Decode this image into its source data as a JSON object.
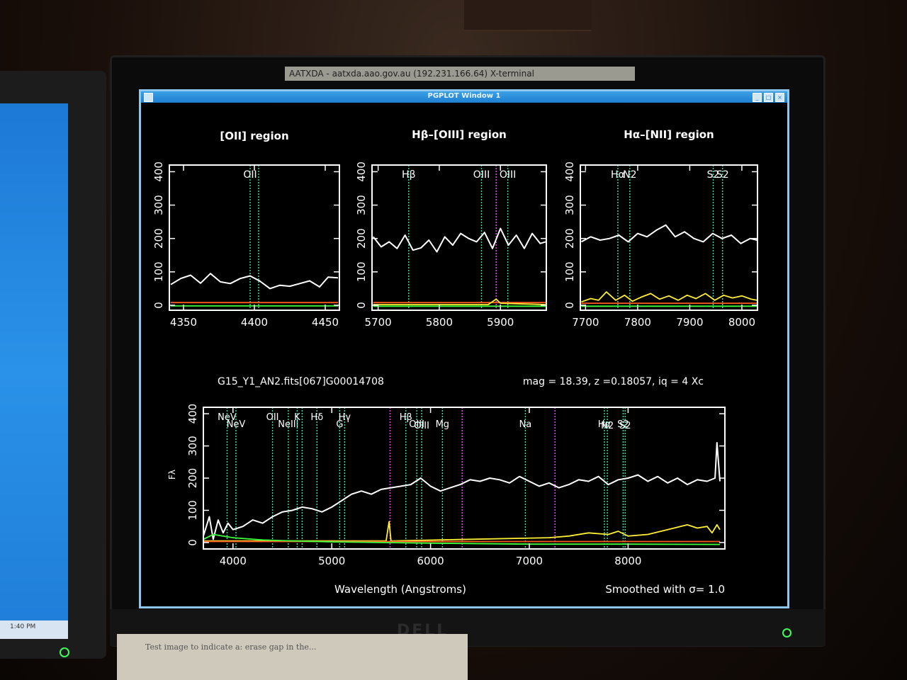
{
  "xterm_title": "AATXDA - aatxda.aao.gov.au (192.231.166.64) X-terminal",
  "window": {
    "title": "PGPLOT Window 1"
  },
  "left_monitor": {
    "clock": "1:40 PM"
  },
  "monitor_brand": "DELL",
  "note_text": "Test image to indicate a: erase gap in the...",
  "chart_data": [
    {
      "id": "oii",
      "type": "line",
      "title": "[OII] region",
      "xlim": [
        4340,
        4460
      ],
      "ylim": [
        -15,
        420
      ],
      "xticks": [
        4350,
        4400,
        4450
      ],
      "yticks": [
        0,
        100,
        200,
        300,
        400
      ],
      "lines": [
        {
          "x": 4397,
          "color": "#33e5b0",
          "label": "OII"
        },
        {
          "x": 4403,
          "color": "#33e5b0",
          "label": ""
        }
      ],
      "series": [
        {
          "color": "#ffffff",
          "x": [
            4341,
            4348,
            4355,
            4362,
            4369,
            4376,
            4383,
            4390,
            4397,
            4404,
            4411,
            4418,
            4425,
            4432,
            4439,
            4446,
            4452,
            4459
          ],
          "y": [
            62,
            80,
            90,
            66,
            95,
            70,
            65,
            80,
            88,
            72,
            50,
            60,
            57,
            65,
            73,
            55,
            84,
            82
          ]
        },
        {
          "color": "#ff5a1e",
          "x": [
            4341,
            4459
          ],
          "y": [
            8,
            8
          ]
        },
        {
          "color": "#3cff3c",
          "x": [
            4341,
            4459
          ],
          "y": [
            -2,
            -2
          ]
        }
      ]
    },
    {
      "id": "hb_oiii",
      "type": "line",
      "title": "Hβ–[OIII] region",
      "xlim": [
        5690,
        5975
      ],
      "ylim": [
        -15,
        420
      ],
      "xticks": [
        5700,
        5800,
        5900
      ],
      "yticks": [
        0,
        100,
        200,
        300,
        400
      ],
      "lines": [
        {
          "x": 5750,
          "color": "#33e5b0",
          "label": "Hβ"
        },
        {
          "x": 5869,
          "color": "#33e5b0",
          "label": "OIII"
        },
        {
          "x": 5893,
          "color": "#ff44ff",
          "label": ""
        },
        {
          "x": 5912,
          "color": "#33e5b0",
          "label": "OIII"
        }
      ],
      "series": [
        {
          "color": "#ffffff",
          "x": [
            5692,
            5705,
            5718,
            5731,
            5744,
            5757,
            5770,
            5783,
            5796,
            5809,
            5822,
            5835,
            5848,
            5861,
            5874,
            5887,
            5900,
            5913,
            5926,
            5939,
            5952,
            5965,
            5974
          ],
          "y": [
            205,
            175,
            190,
            170,
            210,
            165,
            172,
            195,
            160,
            205,
            180,
            215,
            200,
            190,
            218,
            170,
            230,
            180,
            210,
            170,
            215,
            185,
            190
          ]
        },
        {
          "color": "#ff5a1e",
          "x": [
            5692,
            5974
          ],
          "y": [
            8,
            8
          ]
        },
        {
          "color": "#ffee33",
          "x": [
            5692,
            5880,
            5893,
            5900,
            5974
          ],
          "y": [
            2,
            2,
            18,
            6,
            2
          ]
        },
        {
          "color": "#3cff3c",
          "x": [
            5692,
            5974
          ],
          "y": [
            -3,
            -3
          ]
        }
      ]
    },
    {
      "id": "ha_nii",
      "type": "line",
      "title": "Hα–[NII] region",
      "xlim": [
        7690,
        8030
      ],
      "ylim": [
        -15,
        420
      ],
      "xticks": [
        7700,
        7800,
        7900,
        8000
      ],
      "yticks": [
        0,
        100,
        200,
        300,
        400
      ],
      "lines": [
        {
          "x": 7762,
          "color": "#33e5b0",
          "label": "Hα"
        },
        {
          "x": 7785,
          "color": "#33e5b0",
          "label": "N2"
        },
        {
          "x": 7945,
          "color": "#33e5b0",
          "label": "S2"
        },
        {
          "x": 7963,
          "color": "#33e5b0",
          "label": "S2"
        }
      ],
      "series": [
        {
          "color": "#ffffff",
          "x": [
            7692,
            7710,
            7728,
            7746,
            7764,
            7782,
            7800,
            7818,
            7836,
            7854,
            7872,
            7890,
            7908,
            7926,
            7944,
            7962,
            7980,
            7998,
            8016,
            8029
          ],
          "y": [
            190,
            205,
            195,
            200,
            210,
            190,
            215,
            205,
            225,
            240,
            205,
            220,
            200,
            190,
            215,
            200,
            210,
            185,
            200,
            195
          ]
        },
        {
          "color": "#ffee33",
          "x": [
            7692,
            7710,
            7725,
            7740,
            7758,
            7775,
            7790,
            7808,
            7825,
            7842,
            7860,
            7878,
            7895,
            7912,
            7930,
            7948,
            7965,
            7982,
            8000,
            8018,
            8029
          ],
          "y": [
            10,
            20,
            15,
            40,
            15,
            30,
            12,
            25,
            35,
            18,
            28,
            15,
            30,
            20,
            35,
            15,
            30,
            22,
            28,
            18,
            15
          ]
        },
        {
          "color": "#ff5a1e",
          "x": [
            7692,
            8029
          ],
          "y": [
            6,
            6
          ]
        },
        {
          "color": "#3cff3c",
          "x": [
            7692,
            8029
          ],
          "y": [
            -3,
            -3
          ]
        }
      ]
    },
    {
      "id": "full",
      "type": "line",
      "header_left": "G15_Y1_AN2.fits[067]G00014708",
      "header_right": "mag = 18.39, z =0.18057, iq =  4 Xc",
      "xlabel": "Wavelength (Angstroms)",
      "ylabel": "Fλ",
      "note": "Smoothed with σ= 1.0",
      "xlim": [
        3700,
        8980
      ],
      "ylim": [
        -20,
        420
      ],
      "xticks": [
        4000,
        5000,
        6000,
        7000,
        8000
      ],
      "yticks": [
        0,
        100,
        200,
        300,
        400
      ],
      "lines": [
        {
          "x": 3940,
          "color": "#33e5b0",
          "label": "NeV"
        },
        {
          "x": 4030,
          "color": "#33e5b0",
          "label": "NeV"
        },
        {
          "x": 4400,
          "color": "#33e5b0",
          "label": "OII"
        },
        {
          "x": 4560,
          "color": "#33e5b0",
          "label": "NeIII"
        },
        {
          "x": 4650,
          "color": "#33e5b0",
          "label": "K"
        },
        {
          "x": 4700,
          "color": "#33e5b0",
          "label": ""
        },
        {
          "x": 4850,
          "color": "#33e5b0",
          "label": "Hδ"
        },
        {
          "x": 5080,
          "color": "#33e5b0",
          "label": "G"
        },
        {
          "x": 5130,
          "color": "#33e5b0",
          "label": "Hγ"
        },
        {
          "x": 5590,
          "color": "#ff44ff",
          "label": ""
        },
        {
          "x": 5750,
          "color": "#33e5b0",
          "label": "Hβ"
        },
        {
          "x": 5860,
          "color": "#33e5b0",
          "label": "OIII"
        },
        {
          "x": 5910,
          "color": "#33e5b0",
          "label": "OIII"
        },
        {
          "x": 6120,
          "color": "#33e5b0",
          "label": "Mg"
        },
        {
          "x": 6320,
          "color": "#ff44ff",
          "label": ""
        },
        {
          "x": 6960,
          "color": "#33e5b0",
          "label": "Na"
        },
        {
          "x": 7260,
          "color": "#ff44ff",
          "label": ""
        },
        {
          "x": 7760,
          "color": "#33e5b0",
          "label": "Hα"
        },
        {
          "x": 7790,
          "color": "#33e5b0",
          "label": "N2"
        },
        {
          "x": 7950,
          "color": "#33e5b0",
          "label": "S2"
        },
        {
          "x": 7970,
          "color": "#33e5b0",
          "label": "S2"
        }
      ],
      "series": [
        {
          "color": "#ffffff",
          "x": [
            3700,
            3760,
            3800,
            3850,
            3900,
            3950,
            4000,
            4100,
            4200,
            4300,
            4400,
            4500,
            4600,
            4700,
            4800,
            4900,
            5000,
            5100,
            5200,
            5300,
            5400,
            5500,
            5600,
            5700,
            5800,
            5900,
            6000,
            6100,
            6200,
            6300,
            6400,
            6500,
            6600,
            6700,
            6800,
            6900,
            7000,
            7100,
            7200,
            7300,
            7400,
            7500,
            7600,
            7700,
            7800,
            7900,
            8000,
            8100,
            8200,
            8300,
            8400,
            8500,
            8600,
            8700,
            8800,
            8880,
            8900,
            8930
          ],
          "y": [
            20,
            80,
            10,
            70,
            30,
            60,
            40,
            50,
            70,
            60,
            80,
            95,
            100,
            110,
            105,
            95,
            110,
            130,
            150,
            160,
            150,
            165,
            170,
            175,
            180,
            200,
            175,
            160,
            170,
            180,
            195,
            190,
            200,
            195,
            185,
            205,
            190,
            175,
            185,
            170,
            180,
            195,
            190,
            205,
            180,
            195,
            200,
            210,
            190,
            205,
            185,
            200,
            180,
            195,
            190,
            200,
            310,
            190
          ]
        },
        {
          "color": "#ffee33",
          "x": [
            3700,
            5550,
            5580,
            5600,
            5620,
            7200,
            7400,
            7600,
            7800,
            7900,
            8000,
            8200,
            8400,
            8600,
            8700,
            8800,
            8850,
            8900,
            8930
          ],
          "y": [
            5,
            5,
            65,
            5,
            5,
            15,
            20,
            30,
            25,
            35,
            20,
            25,
            40,
            55,
            45,
            50,
            30,
            55,
            40
          ]
        },
        {
          "color": "#ff5a1e",
          "x": [
            3700,
            8930
          ],
          "y": [
            3,
            3
          ]
        },
        {
          "color": "#3cff3c",
          "x": [
            3700,
            3800,
            4000,
            4300,
            4600,
            5000,
            6000,
            7000,
            8000,
            8930
          ],
          "y": [
            10,
            25,
            15,
            8,
            5,
            2,
            -2,
            -5,
            -5,
            -6
          ]
        }
      ]
    }
  ]
}
